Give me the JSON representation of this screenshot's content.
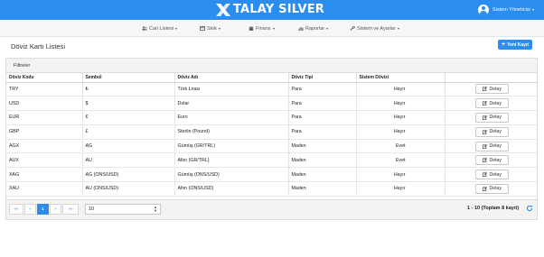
{
  "header": {
    "brand": "TALAY SILVER",
    "user_name": "Sistem Yöneticisi"
  },
  "menu": [
    {
      "label": "Cari Listesi",
      "icon": "users-icon"
    },
    {
      "label": "Stok",
      "icon": "box-icon"
    },
    {
      "label": "Finans",
      "icon": "coins-icon"
    },
    {
      "label": "Raporlar",
      "icon": "chart-icon"
    },
    {
      "label": "Sistem ve Ayarlar",
      "icon": "wrench-icon"
    }
  ],
  "page": {
    "title": "Döviz Kartı Listesi",
    "new_button": "Yeni Kayıt",
    "filters_label": "Filtreler"
  },
  "table": {
    "columns": [
      "Döviz Kodu",
      "Sembol",
      "Döviz Adı",
      "Döviz Tipi",
      "Sistem Dövizi",
      ""
    ],
    "detail_label": "Detay",
    "rows": [
      {
        "code": "TRY",
        "symbol": "₺",
        "name": "Türk Lirası",
        "type": "Para",
        "system": "Hayır"
      },
      {
        "code": "USD",
        "symbol": "$",
        "name": "Dolar",
        "type": "Para",
        "system": "Hayır"
      },
      {
        "code": "EUR",
        "symbol": "€",
        "name": "Euro",
        "type": "Para",
        "system": "Hayır"
      },
      {
        "code": "GBP",
        "symbol": "£",
        "name": "Sterlin (Pound)",
        "type": "Para",
        "system": "Hayır"
      },
      {
        "code": "AGX",
        "symbol": "AG",
        "name": "Gümüş (GR/TRL)",
        "type": "Maden",
        "system": "Evet"
      },
      {
        "code": "AUX",
        "symbol": "AU",
        "name": "Altın (GR/TRL)",
        "type": "Maden",
        "system": "Evet"
      },
      {
        "code": "XAG",
        "symbol": "AG (ONS/USD)",
        "name": "Gümüş (ONS/USD)",
        "type": "Maden",
        "system": "Hayır"
      },
      {
        "code": "XAU",
        "symbol": "AU (ONS/USD)",
        "name": "Altın (ONS/USD)",
        "type": "Maden",
        "system": "Hayır"
      }
    ]
  },
  "pagination": {
    "first": "««",
    "prev": "«",
    "current": "1",
    "next": "»",
    "last": "»»",
    "page_size": "10",
    "summary": "1 - 10 (Toplam 8 kayıt)"
  },
  "colors": {
    "primary": "#2b8ded",
    "header_bg": "#2b8ded",
    "menu_bg": "#f6f6f6",
    "filter_bg": "#f3f3f3"
  }
}
